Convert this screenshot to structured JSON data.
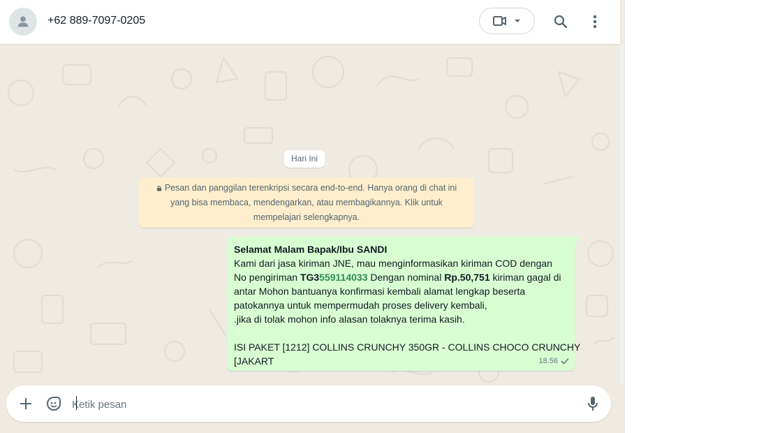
{
  "header": {
    "contact_name": "+62 889-7097-0205",
    "icons": [
      "avatar-icon",
      "video-call-icon",
      "chevron-down-icon",
      "search-icon",
      "menu-icon"
    ]
  },
  "chat": {
    "date_chip": "Hari Ini",
    "encryption_notice": "Pesan dan panggilan terenkripsi secara end-to-end. Hanya orang di chat ini yang bisa membaca, mendengarkan, atau membagikannya. Klik untuk mempelajari selengkapnya.",
    "message": {
      "greeting": "Selamat Malam Bapak/Ibu SANDI",
      "line2": "Kami dari jasa kiriman JNE, mau menginformasikan kiriman COD dengan",
      "line3_prefix": "No pengiriman ",
      "tracking_prefix": "TG3",
      "tracking_number": "559114033",
      "line3_mid": " Dengan nominal ",
      "amount": "Rp.50,751",
      "line3_suffix": " kiriman gagal di",
      "line4": "antar Mohon bantuanya konfirmasi kembali alamat lengkap beserta",
      "line5": "patokannya untuk mempermudah proses delivery kembali,",
      "line6": " .jika di tolak mohon info alasan tolaknya terima kasih.",
      "line8": "ISI PAKET [1212] COLLINS CRUNCHY 350GR - COLLINS CHOCO CRUNCHY",
      "line9": "[JAKART",
      "time": "18.56",
      "status": "sent"
    }
  },
  "composer": {
    "placeholder": "Ketik pesan"
  },
  "colors": {
    "wallpaper": "#efeae2",
    "outgoing_bubble": "#d9fdd3",
    "encryption_bg": "#ffeecd",
    "tracking_link": "#2e8b57"
  }
}
